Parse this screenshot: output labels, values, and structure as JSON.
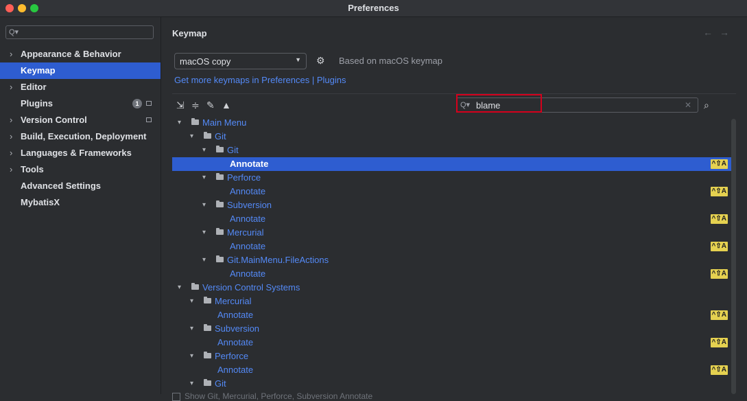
{
  "window": {
    "title": "Preferences"
  },
  "sidebar": {
    "search_placeholder": "",
    "items": [
      {
        "label": "Appearance & Behavior",
        "arrow": "›",
        "selected": false
      },
      {
        "label": "Keymap",
        "arrow": "",
        "selected": true
      },
      {
        "label": "Editor",
        "arrow": "›",
        "selected": false
      },
      {
        "label": "Plugins",
        "arrow": "",
        "selected": false,
        "badge": "1"
      },
      {
        "label": "Version Control",
        "arrow": "›",
        "selected": false
      },
      {
        "label": "Build, Execution, Deployment",
        "arrow": "›",
        "selected": false
      },
      {
        "label": "Languages & Frameworks",
        "arrow": "›",
        "selected": false
      },
      {
        "label": "Tools",
        "arrow": "›",
        "selected": false
      },
      {
        "label": "Advanced Settings",
        "arrow": "",
        "selected": false
      },
      {
        "label": "MybatisX",
        "arrow": "",
        "selected": false
      }
    ]
  },
  "main": {
    "title": "Keymap",
    "nav_back": "←",
    "nav_forward": "→",
    "keymap_value": "macOS copy",
    "based_on": "Based on macOS keymap",
    "more_link": "Get more keymaps in Preferences | Plugins",
    "search_value": "blame",
    "bottom_text": "Show Git, Mercurial, Perforce, Subversion Annotate"
  },
  "tree": [
    {
      "level": 0,
      "type": "folder",
      "label": "Main Menu",
      "expanded": true
    },
    {
      "level": 1,
      "type": "folder",
      "label": "Git",
      "expanded": true
    },
    {
      "level": 2,
      "type": "folder",
      "label": "Git",
      "expanded": true
    },
    {
      "level": 3,
      "type": "action",
      "label": "Annotate",
      "selected": true,
      "shortcut": "^⇧A"
    },
    {
      "level": 2,
      "type": "folder",
      "label": "Perforce",
      "expanded": true
    },
    {
      "level": 3,
      "type": "action",
      "label": "Annotate",
      "shortcut": "^⇧A"
    },
    {
      "level": 2,
      "type": "folder",
      "label": "Subversion",
      "expanded": true
    },
    {
      "level": 3,
      "type": "action",
      "label": "Annotate",
      "shortcut": "^⇧A"
    },
    {
      "level": 2,
      "type": "folder",
      "label": "Mercurial",
      "expanded": true
    },
    {
      "level": 3,
      "type": "action",
      "label": "Annotate",
      "shortcut": "^⇧A"
    },
    {
      "level": 2,
      "type": "folder",
      "label": "Git.MainMenu.FileActions",
      "expanded": true
    },
    {
      "level": 3,
      "type": "action",
      "label": "Annotate",
      "shortcut": "^⇧A"
    },
    {
      "level": 0,
      "type": "folder",
      "label": "Version Control Systems",
      "expanded": true
    },
    {
      "level": 1,
      "type": "folder",
      "label": "Mercurial",
      "expanded": true
    },
    {
      "level": 2,
      "type": "action",
      "label": "Annotate",
      "shortcut": "^⇧A"
    },
    {
      "level": 1,
      "type": "folder",
      "label": "Subversion",
      "expanded": true
    },
    {
      "level": 2,
      "type": "action",
      "label": "Annotate",
      "shortcut": "^⇧A"
    },
    {
      "level": 1,
      "type": "folder",
      "label": "Perforce",
      "expanded": true
    },
    {
      "level": 2,
      "type": "action",
      "label": "Annotate",
      "shortcut": "^⇧A"
    },
    {
      "level": 1,
      "type": "folder",
      "label": "Git",
      "expanded": true
    }
  ],
  "colors": {
    "accent": "#2e5dd0",
    "link": "#548af7",
    "shortcut_bg": "#e5d150",
    "highlight": "#d6001c"
  },
  "icons": {
    "toolbar": [
      "expand-all-icon",
      "collapse-all-icon",
      "edit-icon",
      "warning-icon"
    ],
    "other": [
      "gear-icon",
      "find-shortcut-icon",
      "folder-icon",
      "main-menu-icon"
    ]
  }
}
